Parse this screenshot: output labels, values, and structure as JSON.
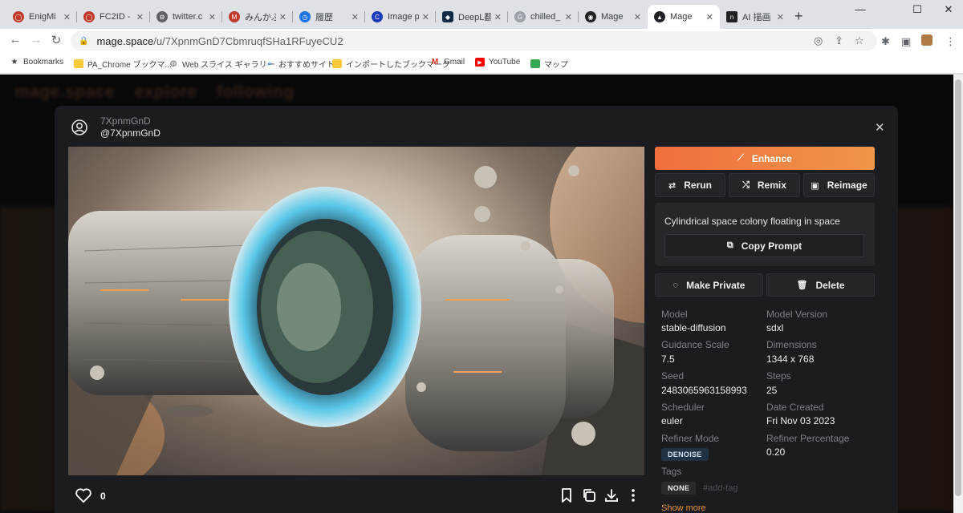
{
  "browser": {
    "tabs": [
      {
        "title": "EnigMi",
        "icon": "opera-icon",
        "color": "#c0392b"
      },
      {
        "title": "FC2ID -",
        "icon": "opera-icon",
        "color": "#c0392b"
      },
      {
        "title": "twitter.c",
        "icon": "settings-gear-icon",
        "color": "#5f6368"
      },
      {
        "title": "みんかぶ",
        "icon": "minkabu-icon",
        "color": "#c0392b"
      },
      {
        "title": "履歴",
        "icon": "history-icon",
        "color": "#1a73e8"
      },
      {
        "title": "Image p",
        "icon": "c-logo-icon",
        "color": "#1a3bb8"
      },
      {
        "title": "DeepL翻",
        "icon": "deepl-icon",
        "color": "#0f2b46"
      },
      {
        "title": "chilled_",
        "icon": "google-g-icon",
        "color": "#9aa0a6"
      },
      {
        "title": "Mage",
        "icon": "mage-icon",
        "color": "#202124"
      },
      {
        "title": "Mage",
        "icon": "mage-triangle-icon",
        "color": "#202124"
      },
      {
        "title": "AI 描画",
        "icon": "notion-icon",
        "color": "#202124"
      }
    ],
    "new_tab": "+",
    "window_controls": {
      "minimize": "—",
      "maximize": "☐",
      "close": "✕"
    },
    "url_host": "mage.space",
    "url_path": "/u/7XpnmGnD7CbmruqfSHa1RFuyeCU2",
    "bookmarks": [
      {
        "label": "Bookmarks",
        "icon": "star-icon"
      },
      {
        "label": "PA_Chrome ブックマ...",
        "icon": "folder-icon"
      },
      {
        "label": "Web スライス ギャラリー",
        "icon": "globe-icon"
      },
      {
        "label": "おすすめサイト",
        "icon": "search-icon"
      },
      {
        "label": "インポートしたブックマーク",
        "icon": "folder-icon"
      },
      {
        "label": "Gmail",
        "icon": "gmail-icon"
      },
      {
        "label": "YouTube",
        "icon": "youtube-icon"
      },
      {
        "label": "マップ",
        "icon": "maps-icon"
      }
    ]
  },
  "background_nav": {
    "brand": "mage.space",
    "links": [
      "explore",
      "following"
    ]
  },
  "modal": {
    "username": "7XpnmGnD",
    "handle": "@7XpnmGnD",
    "close": "✕",
    "like_count": "0",
    "enhance_label": "Enhance",
    "rerun_label": "Rerun",
    "remix_label": "Remix",
    "reimage_label": "Reimage",
    "prompt": "Cylindrical space colony floating in space",
    "copy_prompt_label": "Copy Prompt",
    "make_private_label": "Make Private",
    "delete_label": "Delete",
    "meta": {
      "model_label": "Model",
      "model": "stable-diffusion",
      "model_version_label": "Model Version",
      "model_version": "sdxl",
      "guidance_label": "Guidance Scale",
      "guidance": "7.5",
      "dimensions_label": "Dimensions",
      "dimensions": "1344 x 768",
      "seed_label": "Seed",
      "seed": "2483065963158993",
      "steps_label": "Steps",
      "steps": "25",
      "scheduler_label": "Scheduler",
      "scheduler": "euler",
      "date_label": "Date Created",
      "date": "Fri Nov 03 2023",
      "refiner_mode_label": "Refiner Mode",
      "refiner_mode": "DENOISE",
      "refiner_pct_label": "Refiner Percentage",
      "refiner_pct": "0.20",
      "tags_label": "Tags",
      "tag": "NONE",
      "add_tag_placeholder": "#add-tag",
      "show_more": "Show more"
    },
    "accent_color": "#f07a40"
  }
}
